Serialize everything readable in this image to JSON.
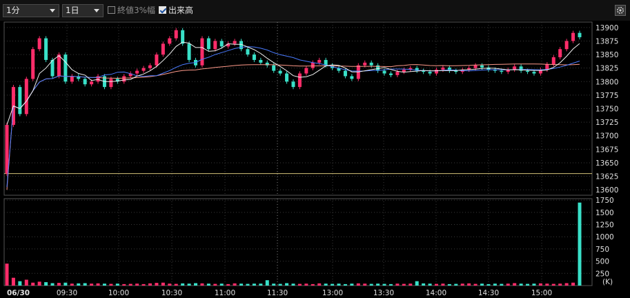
{
  "toolbar": {
    "interval": "1分",
    "range": "1日",
    "opt_close3pct": "終値3%幅",
    "opt_volume": "出来高",
    "close3pct_checked": false,
    "volume_checked": true,
    "settings_icon": "gear-icon"
  },
  "colors": {
    "background": "#000000",
    "up_candle": "#ff2d6a",
    "down_candle": "#39e0c8",
    "ma_short": "#f2f2f2",
    "ma_mid": "#4a7bff",
    "ma_long": "#ff9a8a",
    "h_line": "#d4c27a",
    "grid": "#3a3a3a"
  },
  "chart_data": [
    {
      "type": "candlestick",
      "x_date_label": "06/30",
      "x_ticks": [
        "09:30",
        "10:00",
        "10:30",
        "11:00",
        "11:30",
        "13:00",
        "13:30",
        "14:00",
        "14:30",
        "15:00"
      ],
      "y_ticks": [
        13600,
        13625,
        13650,
        13675,
        13700,
        13725,
        13750,
        13775,
        13800,
        13825,
        13850,
        13875,
        13900
      ],
      "ylim": [
        13590,
        13910
      ],
      "h_line": 13630,
      "grid": true,
      "session_break_after": "11:30",
      "series": [
        {
          "name": "",
          "kind": "close",
          "values": [
            13720,
            13790,
            13740,
            13805,
            13860,
            13880,
            13840,
            13810,
            13850,
            13800,
            13810,
            13805,
            13795,
            13800,
            13810,
            13790,
            13805,
            13800,
            13810,
            13815,
            13820,
            13825,
            13830,
            13850,
            13870,
            13880,
            13895,
            13870,
            13840,
            13830,
            13880,
            13860,
            13875,
            13865,
            13870,
            13875,
            13860,
            13850,
            13840,
            13835,
            13830,
            13820,
            13815,
            13800,
            13790,
            13815,
            13825,
            13835,
            13840,
            13830,
            13825,
            13820,
            13810,
            13805,
            13830,
            13835,
            13830,
            13820,
            13815,
            13812,
            13818,
            13822,
            13825,
            13820,
            13818,
            13815,
            13822,
            13826,
            13820,
            13818,
            13822,
            13825,
            13830,
            13826,
            13822,
            13820,
            13818,
            13822,
            13828,
            13820,
            13818,
            13815,
            13822,
            13832,
            13845,
            13860,
            13875,
            13890,
            13882
          ]
        }
      ]
    },
    {
      "type": "bar",
      "title": "",
      "unit": "(K)",
      "y_ticks": [
        250,
        500,
        750,
        1000,
        1250,
        1500,
        1750
      ],
      "ylim": [
        0,
        1780
      ],
      "series": [
        {
          "name": "",
          "values": [
            450,
            160,
            90,
            120,
            60,
            80,
            70,
            50,
            55,
            60,
            40,
            45,
            50,
            40,
            45,
            40,
            35,
            40,
            30,
            35,
            40,
            30,
            45,
            55,
            60,
            40,
            35,
            45,
            40,
            50,
            45,
            40,
            35,
            40,
            30,
            45,
            40,
            35,
            40,
            40,
            110,
            40,
            35,
            50,
            40,
            35,
            40,
            30,
            45,
            40,
            35,
            40,
            30,
            40,
            45,
            40,
            35,
            40,
            35,
            30,
            40,
            35,
            40,
            90,
            45,
            40,
            35,
            40,
            30,
            35,
            40,
            45,
            35,
            40,
            30,
            40,
            35,
            40,
            50,
            40,
            35,
            40,
            45,
            40,
            35,
            40,
            50,
            60,
            1700
          ]
        }
      ]
    }
  ]
}
